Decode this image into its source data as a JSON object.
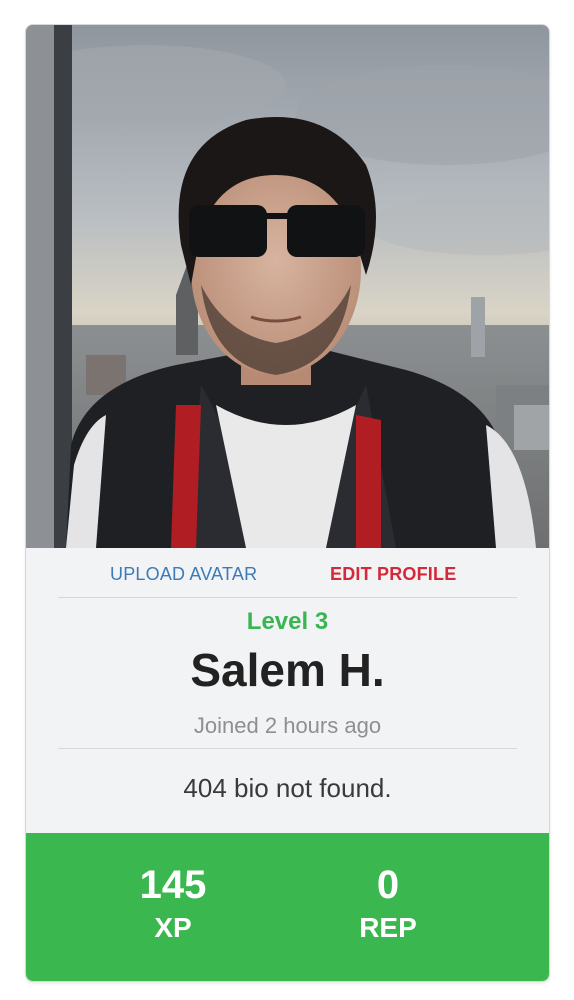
{
  "profile": {
    "avatar_alt": "profile photo",
    "actions": {
      "upload_avatar": "UPLOAD AVATAR",
      "edit_profile": "EDIT PROFILE"
    },
    "level": "Level 3",
    "name": "Salem H.",
    "joined": "Joined 2 hours ago",
    "bio": "404 bio not found."
  },
  "stats": {
    "xp": {
      "value": "145",
      "label": "XP"
    },
    "rep": {
      "value": "0",
      "label": "REP"
    }
  },
  "colors": {
    "accent_green": "#3ab84f",
    "link_blue": "#3d7ab8",
    "edit_red": "#d5293a",
    "card_bg": "#f2f3f5"
  }
}
